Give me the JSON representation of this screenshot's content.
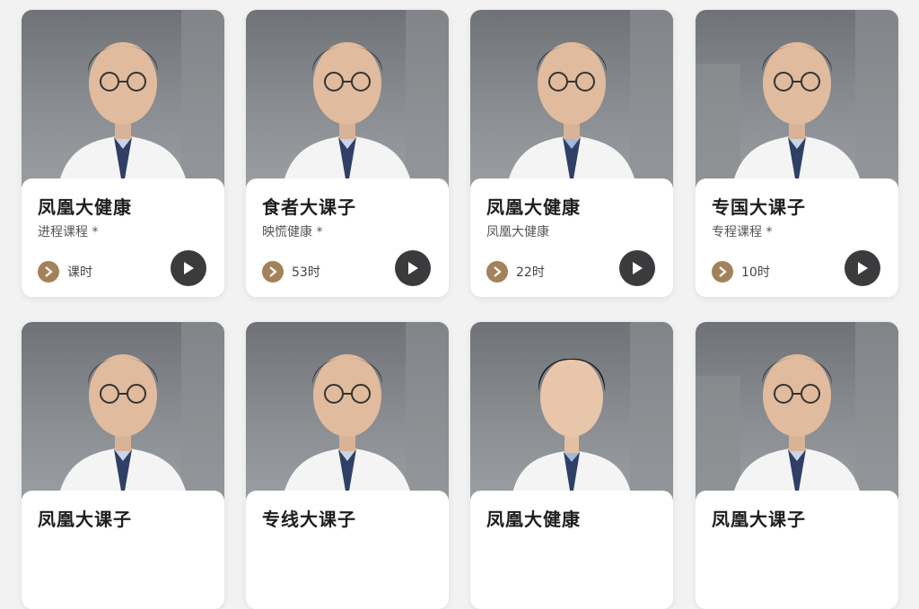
{
  "colors": {
    "background": "#f2f2f3",
    "card": "#ffffff",
    "duration_icon": "#a3815a",
    "play_button": "#3b3b3d",
    "photo_background": "#7d8084"
  },
  "cards": [
    {
      "title": "凤凰大健康",
      "subtitle": "进程课程 *",
      "duration": "课时",
      "play_icon": "play-icon"
    },
    {
      "title": "食者大课子",
      "subtitle": "映慌健康 *",
      "duration": "53时",
      "play_icon": "play-icon"
    },
    {
      "title": "凤凰大健康",
      "subtitle": "凤凰大健康",
      "duration": "22时",
      "play_icon": "play-icon"
    },
    {
      "title": "专国大课子",
      "subtitle": "专程课程 *",
      "duration": "10时",
      "play_icon": "play-icon"
    },
    {
      "title": "凤凰大课子",
      "subtitle": "",
      "duration": "",
      "play_icon": "play-icon"
    },
    {
      "title": "专线大课子",
      "subtitle": "",
      "duration": "",
      "play_icon": "play-icon"
    },
    {
      "title": "凤凰大健康",
      "subtitle": "",
      "duration": "",
      "play_icon": "play-icon"
    },
    {
      "title": "凤凰大课子",
      "subtitle": "",
      "duration": "",
      "play_icon": "play-icon"
    }
  ]
}
